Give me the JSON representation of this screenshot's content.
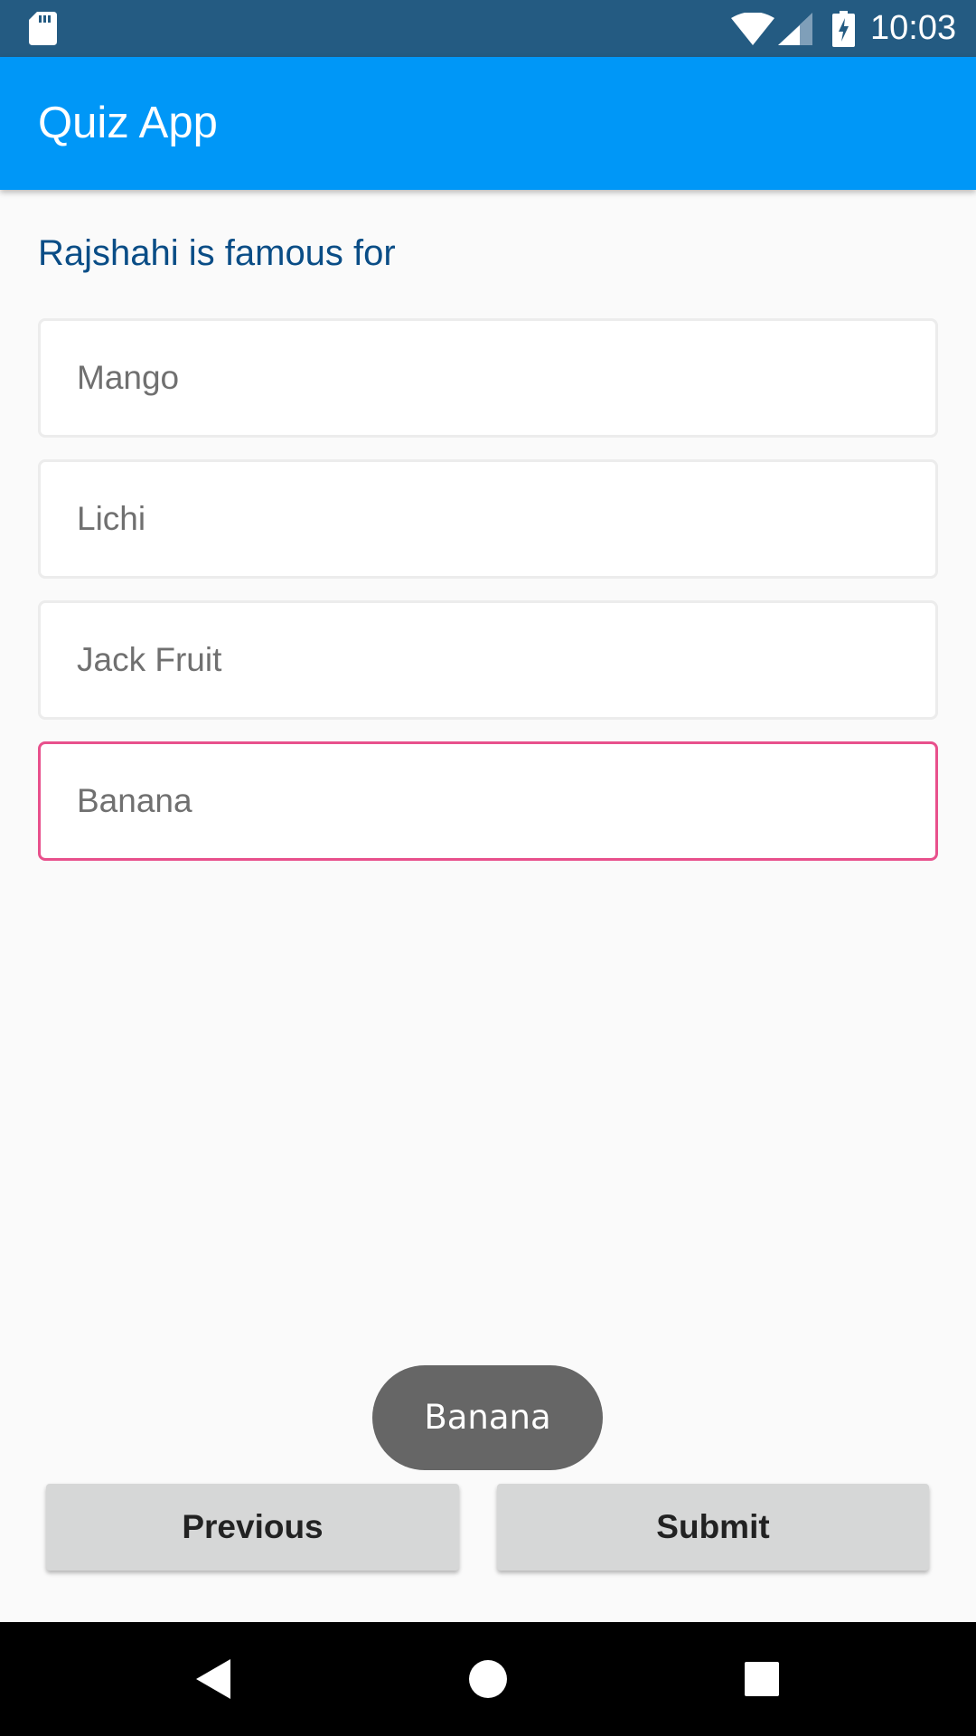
{
  "status_bar": {
    "time": "10:03",
    "icons": [
      "sd-card-icon",
      "wifi-icon",
      "cell-signal-icon",
      "battery-charging-icon"
    ]
  },
  "app_bar": {
    "title": "Quiz App",
    "color": "#0097f7"
  },
  "quiz": {
    "question": "Rajshahi is famous for",
    "options": [
      {
        "label": "Mango",
        "selected": false
      },
      {
        "label": "Lichi",
        "selected": false
      },
      {
        "label": "Jack Fruit",
        "selected": false
      },
      {
        "label": "Banana",
        "selected": true
      }
    ],
    "selected_border_color": "#e8508c"
  },
  "toast": {
    "text": "Banana"
  },
  "buttons": {
    "previous_label": "Previous",
    "submit_label": "Submit"
  },
  "nav_bar": {
    "icons": [
      "back-icon",
      "home-icon",
      "recents-icon"
    ]
  }
}
